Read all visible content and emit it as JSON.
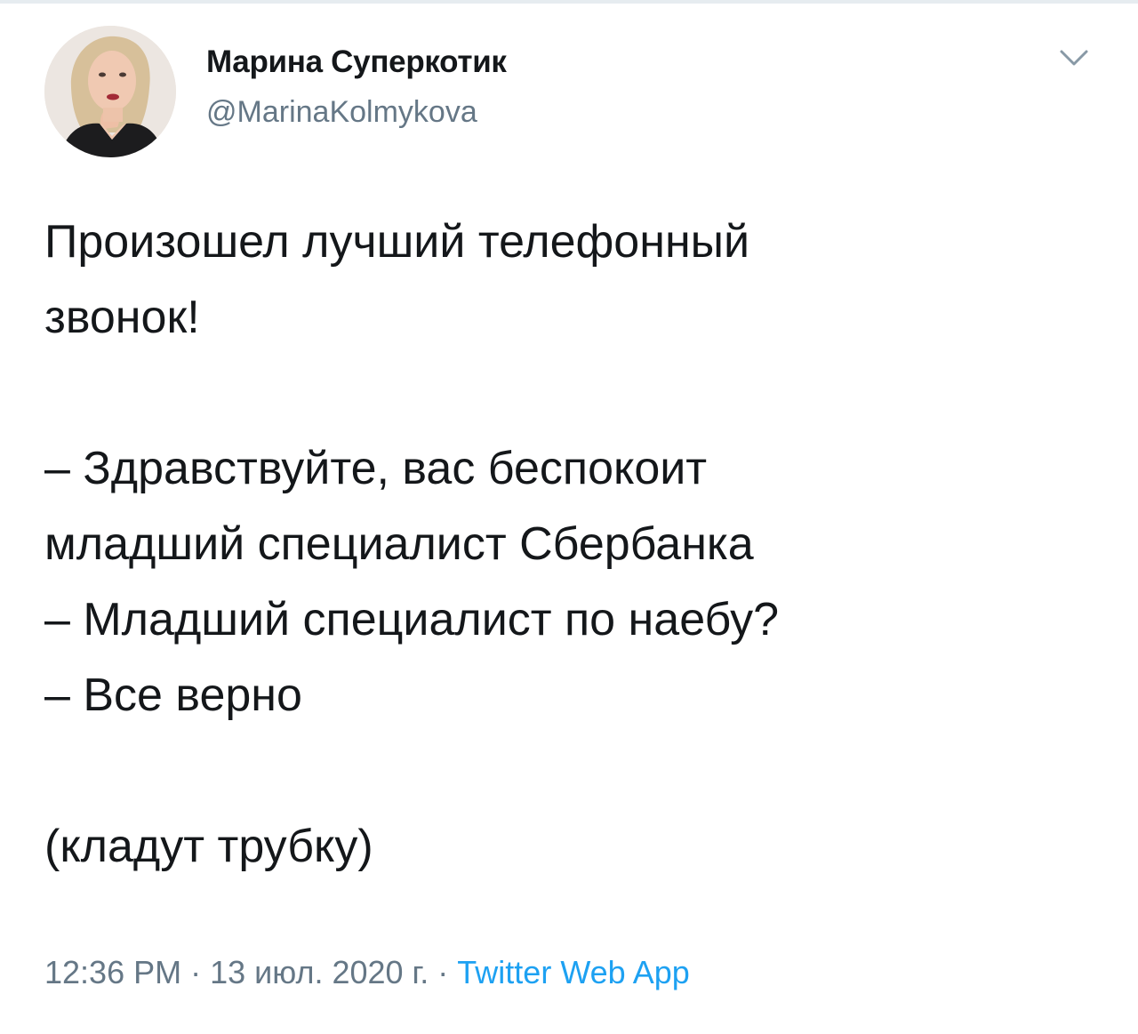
{
  "tweet": {
    "author": {
      "display_name": "Марина Суперкотик",
      "handle": "@MarinaKolmykova"
    },
    "text": "Произошел лучший телефонный\nзвонок!\n\n– Здравствуйте, вас беспокоит\nмладший специалист Сбербанка\n– Младший специалист по наебу?\n– Все верно\n\n(кладут трубку)",
    "meta": {
      "time": "12:36 PM",
      "separator": "·",
      "date": "13 июл. 2020 г.",
      "source": "Twitter Web App"
    },
    "icons": {
      "menu_caret": "chevron-down-icon"
    },
    "colors": {
      "text": "#14171a",
      "secondary": "#657786",
      "link": "#1da1f2"
    }
  }
}
